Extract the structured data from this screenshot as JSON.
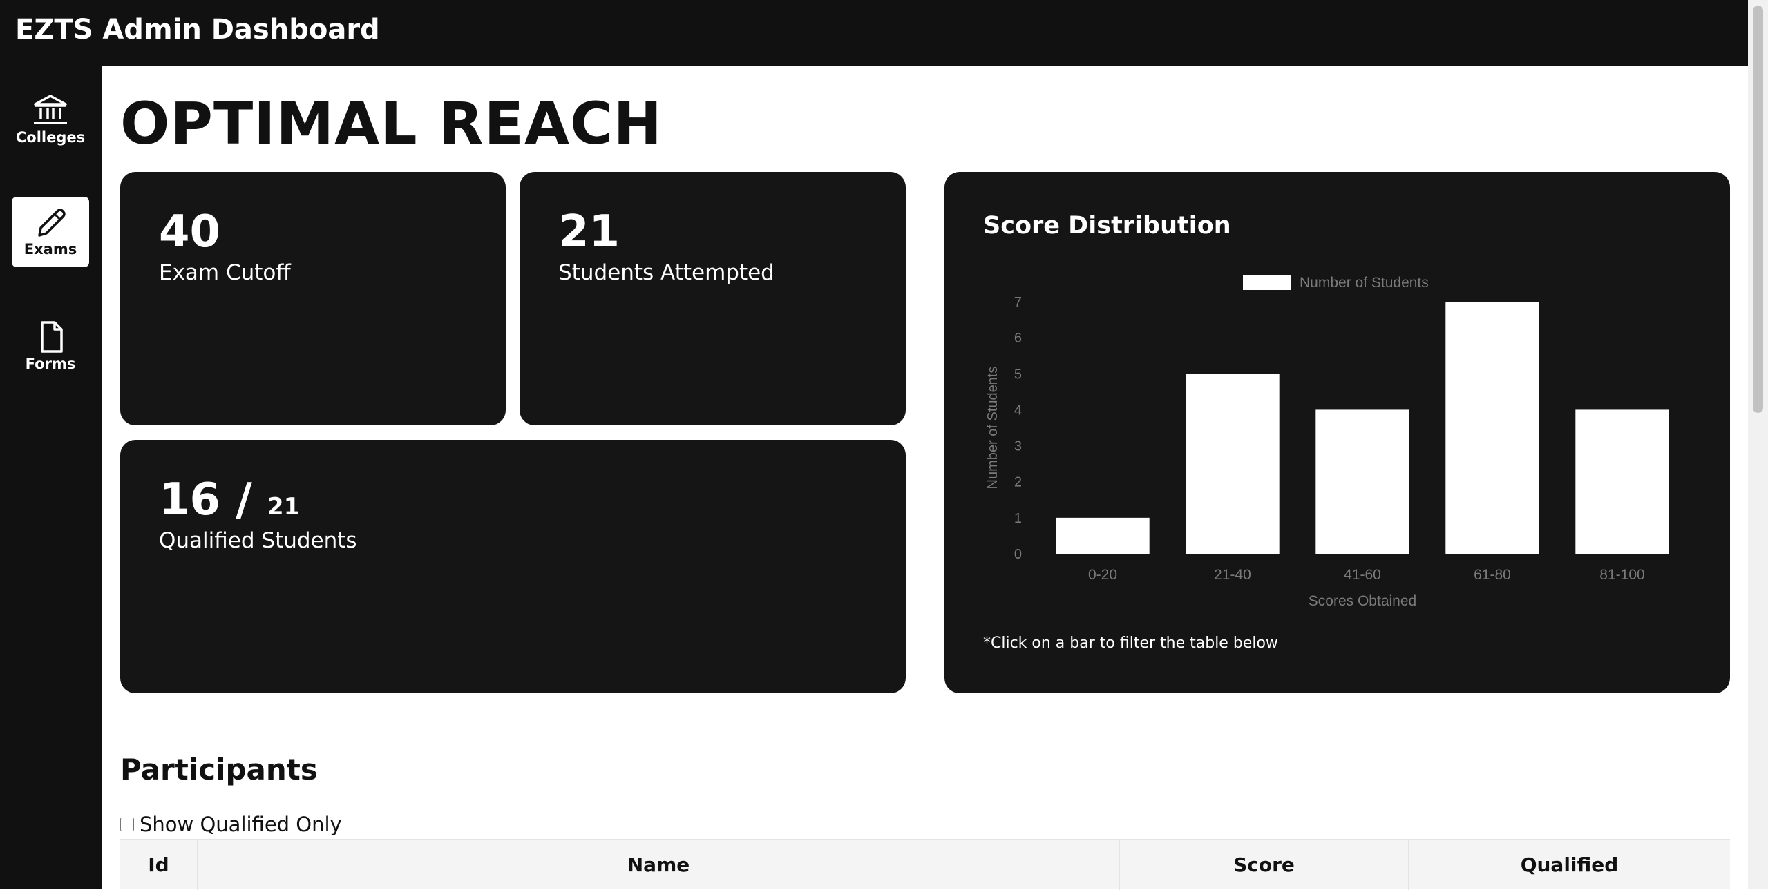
{
  "header": {
    "app_title": "EZTS Admin Dashboard"
  },
  "sidebar": {
    "items": [
      {
        "label": "Colleges",
        "icon": "bank-icon",
        "active": false
      },
      {
        "label": "Exams",
        "icon": "pencil-icon",
        "active": true
      },
      {
        "label": "Forms",
        "icon": "file-icon",
        "active": false
      }
    ]
  },
  "page": {
    "title": "OPTIMAL REACH"
  },
  "stats": {
    "cutoff": {
      "value": "40",
      "label": "Exam Cutoff"
    },
    "attempted": {
      "value": "21",
      "label": "Students Attempted"
    },
    "qualified": {
      "value": "16 /",
      "total": "21",
      "label": "Qualified Students"
    }
  },
  "chart_card": {
    "title": "Score Distribution",
    "note": "*Click on a bar to filter the table below"
  },
  "chart_data": {
    "type": "bar",
    "categories": [
      "0-20",
      "21-40",
      "41-60",
      "61-80",
      "81-100"
    ],
    "series": [
      {
        "name": "Number of Students",
        "values": [
          1,
          5,
          4,
          7,
          4
        ],
        "color": "#ffffff"
      }
    ],
    "xlabel": "Scores Obtained",
    "ylabel": "Number of Students",
    "ylim": [
      0,
      7
    ],
    "yticks": [
      "0",
      "1",
      "2",
      "3",
      "4",
      "5",
      "6",
      "7"
    ],
    "legend": "top-center",
    "grid": false
  },
  "participants": {
    "title": "Participants",
    "filter_label": "Show Qualified Only",
    "filter_checked": false,
    "columns": [
      "Id",
      "Name",
      "Score",
      "Qualified"
    ]
  },
  "colors": {
    "dark": "#111111",
    "card": "#151515",
    "axis_text": "#7a7a7a",
    "table_header": "#f4f4f5"
  }
}
